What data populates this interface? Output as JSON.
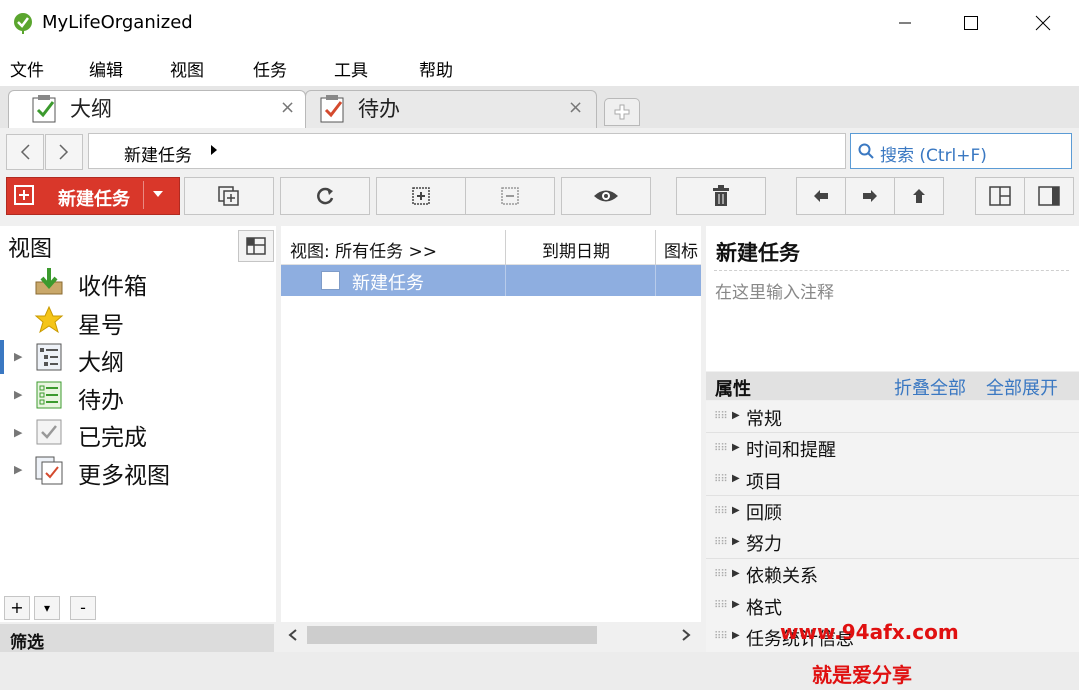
{
  "window": {
    "title": "MyLifeOrganized",
    "controls": [
      "minimize",
      "maximize",
      "close"
    ]
  },
  "menu": [
    "文件",
    "编辑",
    "视图",
    "任务",
    "工具",
    "帮助"
  ],
  "tabs": [
    {
      "label": "大纲",
      "active": true
    },
    {
      "label": "待办",
      "active": false
    }
  ],
  "nav": {
    "breadcrumb": "新建任务",
    "search_placeholder": "搜索 (Ctrl+F)"
  },
  "toolbar": {
    "new_task_label": "新建任务"
  },
  "sidebar": {
    "title": "视图",
    "items": [
      {
        "label": "收件箱",
        "icon": "inbox-icon",
        "expandable": false
      },
      {
        "label": "星号",
        "icon": "star-icon",
        "expandable": false
      },
      {
        "label": "大纲",
        "icon": "outline-icon",
        "expandable": true,
        "selected": true
      },
      {
        "label": "待办",
        "icon": "todo-icon",
        "expandable": true
      },
      {
        "label": "已完成",
        "icon": "completed-icon",
        "expandable": true
      },
      {
        "label": "更多视图",
        "icon": "more-views-icon",
        "expandable": true
      }
    ],
    "bottom_buttons": [
      "+",
      "▾",
      "-"
    ],
    "filter_label": "筛选"
  },
  "task_list": {
    "columns": [
      "视图: 所有任务 >>",
      "到期日期",
      "图标"
    ],
    "rows": [
      {
        "title": "新建任务",
        "selected": true
      }
    ]
  },
  "detail": {
    "title": "新建任务",
    "note_placeholder": "在这里输入注释",
    "properties_label": "属性",
    "collapse_all": "折叠全部",
    "expand_all": "全部展开",
    "sections": [
      "常规",
      "时间和提醒",
      "项目",
      "回顾",
      "努力",
      "依赖关系",
      "格式",
      "任务统计信息"
    ]
  },
  "watermark": {
    "line1": "www.94afx.com",
    "line2": "就是爱分享",
    "color": "#e01010"
  },
  "colors": {
    "accent_red": "#d9372a",
    "selection_blue": "#8eaee0",
    "link_blue": "#3a78c2"
  }
}
